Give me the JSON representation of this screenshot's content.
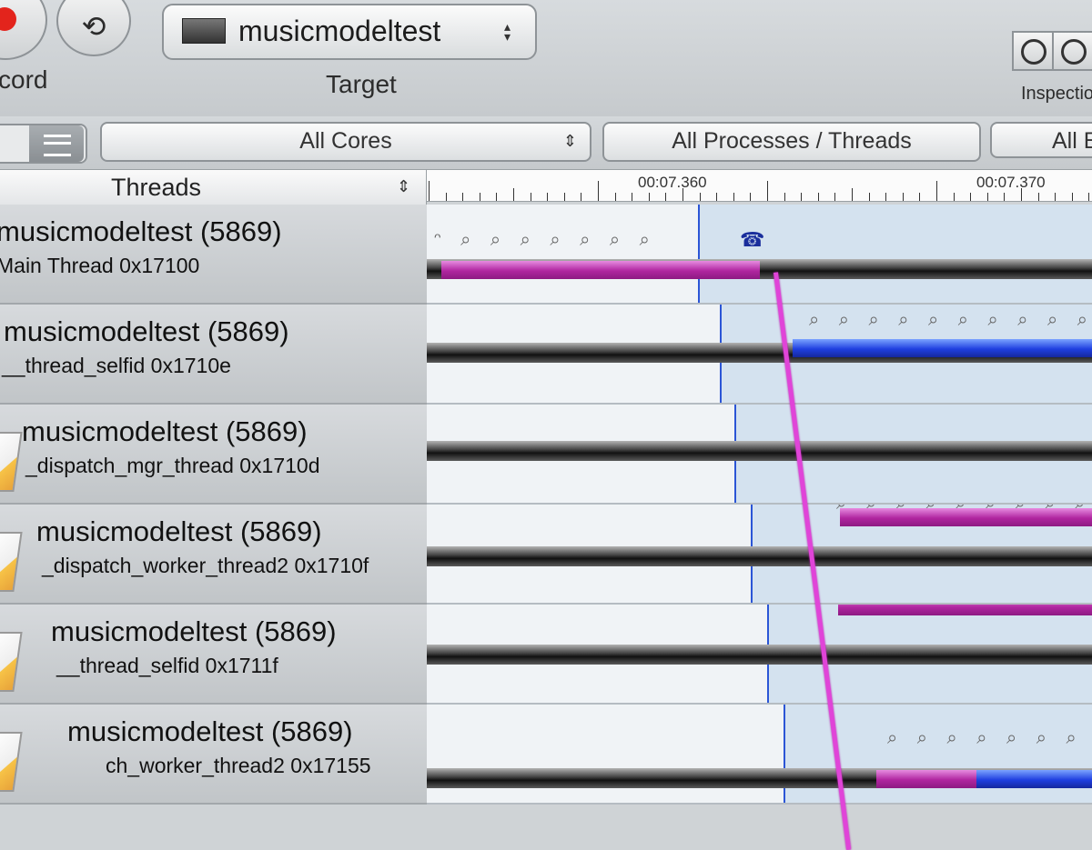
{
  "toolbar": {
    "record_label": "cord",
    "loop_glyph": "⟲",
    "target_label": "Target",
    "target_value": "musicmodeltest",
    "target_stepper": "▴▾",
    "inspection_label": "Inspection"
  },
  "filters": {
    "cores": "All Cores",
    "cores_stepper": "⇕",
    "processes": "All Processes / Threads",
    "events": "All Ev"
  },
  "threads_header": {
    "title": "Threads",
    "stepper": "⇕"
  },
  "ruler": {
    "labels": [
      "00:07.360",
      "00:07.370"
    ]
  },
  "threads": [
    {
      "process": "musicmodeltest (5869)",
      "thread": "Main Thread  0x17100",
      "events": "ᵔ ⌕ ⌕ ⌕ ⌕ ⌕ ⌕ ⌕",
      "phone": "☎"
    },
    {
      "process": "musicmodeltest (5869)",
      "thread": "__thread_selfid  0x1710e",
      "events": "⌕ ⌕ ⌕ ⌕ ⌕ ⌕ ⌕ ⌕ ⌕ ⌕"
    },
    {
      "process": "musicmodeltest (5869)",
      "thread": "_dispatch_mgr_thread  0x1710d",
      "events": ""
    },
    {
      "process": "musicmodeltest (5869)",
      "thread": "_dispatch_worker_thread2  0x1710f",
      "events": "⌕ ⌕ ⌕ ⌕ ⌕ ⌕ ⌕ ⌕ ⌕"
    },
    {
      "process": "musicmodeltest (5869)",
      "thread": "__thread_selfid  0x1711f",
      "events": "⌕ ⌕ ⌕ ⌕ ⌕ ⌕ ⌕ ⌕ ⌕ ⌕"
    },
    {
      "process": "musicmodeltest (5869)",
      "thread": "ch_worker_thread2  0x17155",
      "events": "⌕ ⌕ ⌕ ⌕ ⌕ ⌕ ⌕"
    }
  ],
  "colors": {
    "pink_segment": "#b0259f",
    "blue_segment": "#1f3fe0",
    "playhead": "#e044d8",
    "selection": "#2b55d6"
  }
}
